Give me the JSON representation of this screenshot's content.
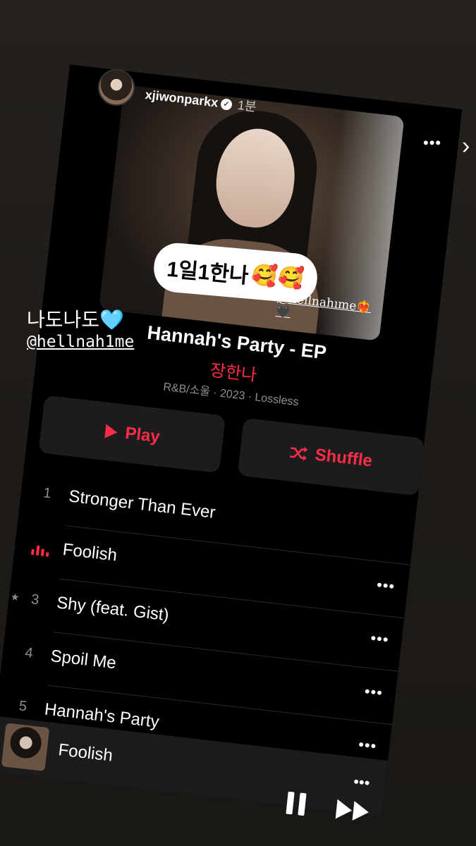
{
  "story": {
    "username": "xjiwonparkx",
    "time": "1분",
    "caption": "나도나도",
    "caption_emoji": "🩵",
    "mention": "@hellnah1me",
    "sticker_text": "1일1한나",
    "sticker_emoji": "🥰🥰",
    "cover_mention": "@hellnahıme"
  },
  "album": {
    "title": "Hannah's Party - EP",
    "artist": "장한나",
    "meta": "R&B/소울 · 2023 · Lossless"
  },
  "buttons": {
    "play": "Play",
    "shuffle": "Shuffle"
  },
  "tracks": [
    {
      "num": "1",
      "title": "Stronger Than Ever"
    },
    {
      "num": "",
      "title": "Foolish"
    },
    {
      "num": "3",
      "title": "Shy (feat. Gist)"
    },
    {
      "num": "4",
      "title": "Spoil Me"
    },
    {
      "num": "5",
      "title": "Hannah's Party"
    }
  ],
  "now_playing": {
    "title": "Foolish"
  },
  "colors": {
    "accent": "#fa2d48",
    "secondary_text": "#8d8d92",
    "button_bg": "#1c1c1e"
  },
  "icons": [
    "verified-icon",
    "more-icon",
    "close-icon",
    "play-icon",
    "shuffle-icon",
    "equalizer-icon",
    "star-icon",
    "pause-icon",
    "forward-icon"
  ]
}
